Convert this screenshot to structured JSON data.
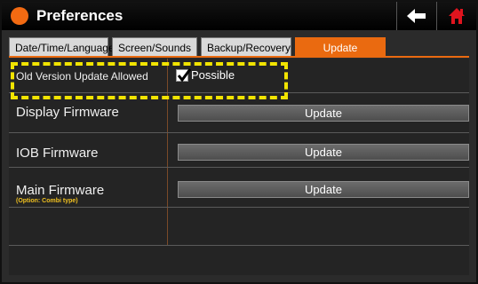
{
  "window": {
    "title": "Preferences"
  },
  "title_buttons": {
    "back_icon": "back-arrow-icon",
    "home_icon": "home-icon"
  },
  "tabs": [
    {
      "label": "Date/Time/Language",
      "active": false
    },
    {
      "label": "Screen/Sounds",
      "active": false
    },
    {
      "label": "Backup/Recovery",
      "active": false
    },
    {
      "label": "Update",
      "active": true
    }
  ],
  "settings": {
    "old_version": {
      "label": "Old Version Update Allowed",
      "checkbox_label": "Possible",
      "checked": true
    },
    "display_firmware": {
      "label": "Display Firmware",
      "button_label": "Update"
    },
    "iob_firmware": {
      "label": "IOB Firmware",
      "button_label": "Update"
    },
    "main_firmware": {
      "label": "Main Firmware",
      "note": "(Option: Combi type)",
      "button_label": "Update"
    }
  },
  "colors": {
    "accent": "#ea6a10",
    "highlight": "#f2e400",
    "background": "#2b2b2b"
  }
}
